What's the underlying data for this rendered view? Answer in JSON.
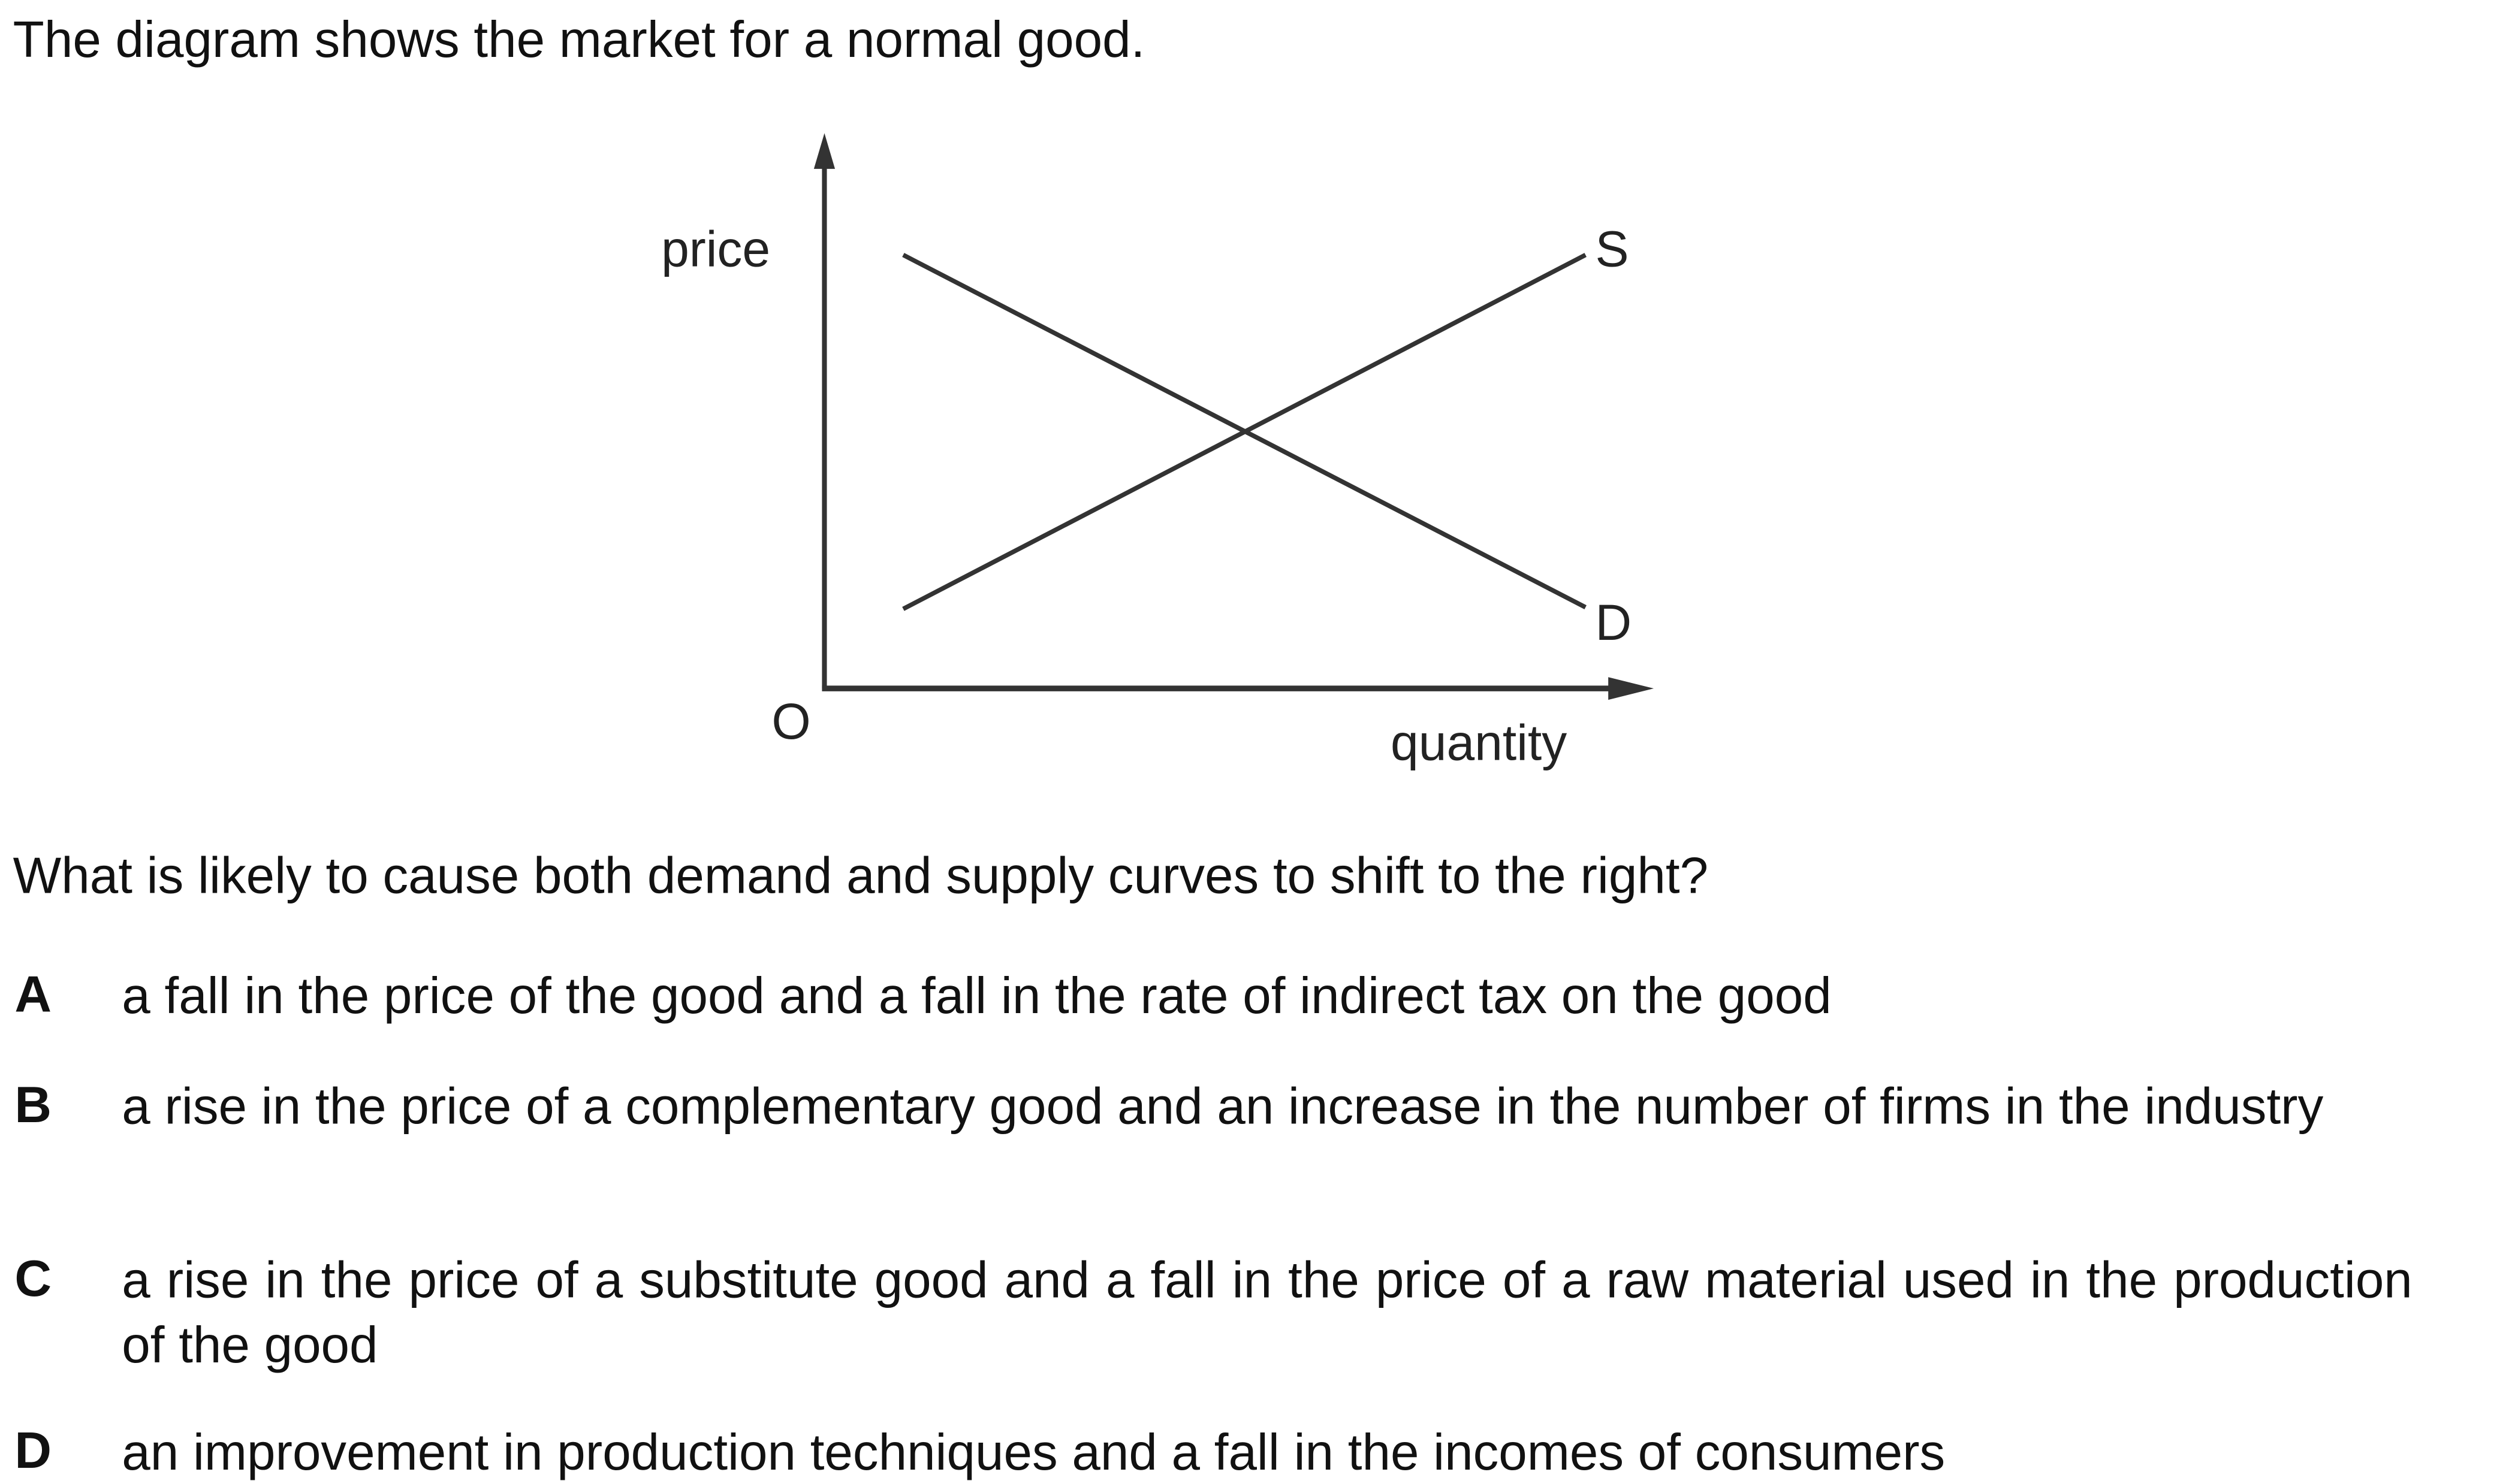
{
  "intro": "The diagram shows the market for a normal good.",
  "diagram": {
    "y_axis_label": "price",
    "x_axis_label": "quantity",
    "origin_label": "O",
    "supply_label": "S",
    "demand_label": "D"
  },
  "question": "What is likely to cause both demand and supply curves to shift to the right?",
  "options": [
    {
      "letter": "A",
      "text": "a fall in the price of the good and a fall in the rate of indirect tax on the good"
    },
    {
      "letter": "B",
      "text": "a rise in the price of a complementary good and an increase in the number of firms in the industry"
    },
    {
      "letter": "C",
      "text": "a rise in the price of a substitute good and a fall in the price of a raw material used in the production of the good"
    },
    {
      "letter": "D",
      "text": "an improvement in production techniques and a fall in the incomes of consumers"
    }
  ]
}
